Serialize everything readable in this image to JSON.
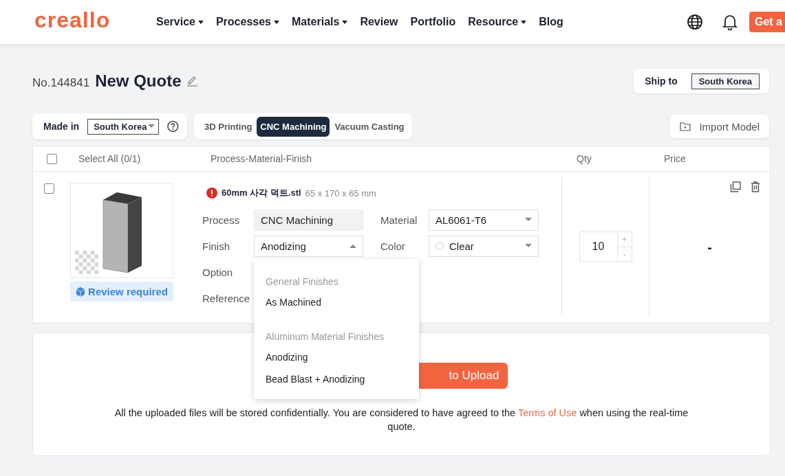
{
  "logo": "creallo",
  "nav": [
    {
      "label": "Service",
      "dropdown": true
    },
    {
      "label": "Processes",
      "dropdown": true
    },
    {
      "label": "Materials",
      "dropdown": true
    },
    {
      "label": "Review",
      "dropdown": false
    },
    {
      "label": "Portfolio",
      "dropdown": false
    },
    {
      "label": "Resource",
      "dropdown": true
    },
    {
      "label": "Blog",
      "dropdown": false
    }
  ],
  "header_button": "Get a",
  "quote": {
    "number": "No.144841",
    "title": "New Quote"
  },
  "ship_to": {
    "label": "Ship to",
    "value": "South Korea"
  },
  "made_in": {
    "label": "Made in",
    "value": "South Korea"
  },
  "process_tabs": [
    {
      "label": "3D Printing",
      "selected": false
    },
    {
      "label": "CNC Machining",
      "selected": true
    },
    {
      "label": "Vacuum Casting",
      "selected": false
    }
  ],
  "import_button": "Import Model",
  "table": {
    "select_all_checked": false,
    "columns": [
      "Select All (0/1)",
      "Process-Material-Finish",
      "Qty",
      "Price"
    ],
    "rows": [
      {
        "checked": false,
        "status": "Review required",
        "file_name": "60mm 사각 덕트.stl",
        "dimensions": "65 x 170 x 65 mm",
        "process": {
          "label": "Process",
          "value": "CNC Machining"
        },
        "material": {
          "label": "Material",
          "value": "AL6061-T6"
        },
        "finish": {
          "label": "Finish",
          "value": "Anodizing",
          "expanded": true
        },
        "color": {
          "label": "Color",
          "value": "Clear"
        },
        "extra_labels": [
          "Option",
          "Reference"
        ],
        "qty": "10",
        "qty_increment": "+",
        "qty_decrement": "-",
        "price": "-"
      }
    ]
  },
  "finish_dropdown": {
    "groups": [
      {
        "heading": "General Finishes",
        "options": [
          "As Machined"
        ]
      },
      {
        "heading": "Aluminum Material Finishes",
        "options": [
          "Anodizing",
          "Bead Blast + Anodizing"
        ]
      }
    ]
  },
  "upload": {
    "button": "to Upload",
    "notice_before": "All the uploaded files will be stored confidentially. You are considered to have agreed to the ",
    "link": "Terms of Use",
    "notice_after": " when using the real-time quote."
  }
}
